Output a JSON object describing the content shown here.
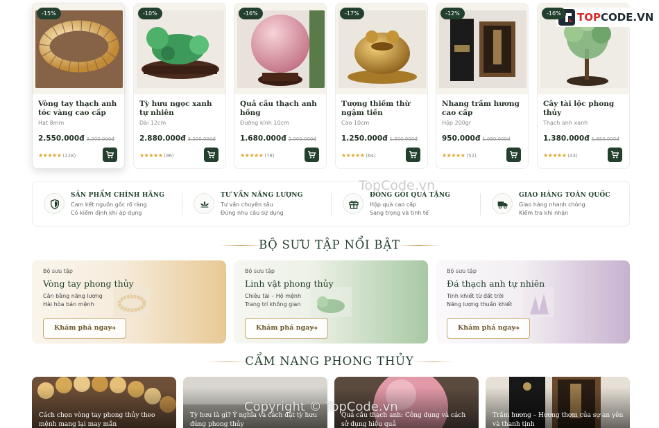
{
  "colors": {
    "primary": "#23402e",
    "gold": "#c6a76a",
    "star": "#e0a52b"
  },
  "products": [
    {
      "badge": "-15%",
      "name": "Vòng tay thạch anh tóc vàng cao cấp",
      "desc": "Hạt 8mm",
      "price": "2.550.000đ",
      "old_price": "3.000.000đ",
      "stars": "★★★★★",
      "reviews": "(128)"
    },
    {
      "badge": "-10%",
      "name": "Tỳ hưu ngọc xanh tự nhiên",
      "desc": "Dài 12cm",
      "price": "2.880.000đ",
      "old_price": "3.200.000đ",
      "stars": "★★★★★",
      "reviews": "(96)"
    },
    {
      "badge": "-16%",
      "name": "Quả cầu thạch anh hồng",
      "desc": "Đường kính 10cm",
      "price": "1.680.000đ",
      "old_price": "2.000.000đ",
      "stars": "★★★★★",
      "reviews": "(78)"
    },
    {
      "badge": "-17%",
      "name": "Tượng thiềm thừ ngậm tiền",
      "desc": "Cao 10cm",
      "price": "1.250.000đ",
      "old_price": "1.500.000đ",
      "stars": "★★★★★",
      "reviews": "(64)"
    },
    {
      "badge": "-12%",
      "name": "Nhang trầm hương cao cấp",
      "desc": "Hộp 200gr",
      "price": "950.000đ",
      "old_price": "1.080.000đ",
      "stars": "★★★★★",
      "reviews": "(52)"
    },
    {
      "badge": "-16%",
      "name": "Cây tài lộc phong thủy",
      "desc": "Thạch anh xanh",
      "price": "1.380.000đ",
      "old_price": "1.650.000đ",
      "stars": "★★★★★",
      "reviews": "(43)"
    }
  ],
  "features": [
    {
      "icon": "shield-icon",
      "title": "SẢN PHẨM CHÍNH HÃNG",
      "line1": "Cam kết nguồn gốc rõ ràng",
      "line2": "Có kiểm định khi áp dụng"
    },
    {
      "icon": "lotus-icon",
      "title": "TƯ VẤN NĂNG LƯỢNG",
      "line1": "Tư vấn chuyên sâu",
      "line2": "Đúng nhu cầu sử dụng"
    },
    {
      "icon": "gift-icon",
      "title": "ĐÓNG GÓI QUÀ TẶNG",
      "line1": "Hộp quà cao cấp",
      "line2": "Sang trọng và tinh tế"
    },
    {
      "icon": "truck-icon",
      "title": "GIAO HÀNG TOÀN QUỐC",
      "line1": "Giao hàng nhanh chóng",
      "line2": "Kiểm tra khi nhận"
    }
  ],
  "collections_heading": "BỘ SƯU TẬP NỔI BẬT",
  "collections": [
    {
      "tag": "Bộ sưu tập",
      "title": "Vòng tay phong thủy",
      "line1": "Cân bằng năng lượng",
      "line2": "Hài hòa bản mệnh",
      "button": "Khám phá ngay",
      "arrow": "→"
    },
    {
      "tag": "Bộ sưu tập",
      "title": "Linh vật phong thủy",
      "line1": "Chiêu tài – Hộ mệnh",
      "line2": "Trang trí không gian",
      "button": "Khám phá ngay",
      "arrow": "→"
    },
    {
      "tag": "Bộ sưu tập",
      "title": "Đá thạch anh tự nhiên",
      "line1": "Tinh khiết từ đất trời",
      "line2": "Năng lượng thuần khiết",
      "button": "Khám phá ngay",
      "arrow": "→"
    }
  ],
  "guide_heading": "CẨM NANG PHONG THỦY",
  "blog": [
    {
      "title": "Cách chọn vòng tay phong thủy theo mệnh mang lại may mắn"
    },
    {
      "title": "Tỳ hưu là gì? Ý nghĩa và cách đặt tỳ hưu đúng phong thủy"
    },
    {
      "title": "Quả cầu thạch anh: Công dụng và cách sử dụng hiệu quả"
    },
    {
      "title": "Trầm hương – Hương thơm của sự an yên và thanh tịnh"
    }
  ],
  "logo": {
    "prefix": "TOP",
    "suffix": "CODE.VN"
  },
  "watermark_top": "TopCode.vn",
  "watermark_bottom": "Copyright © TopCode.vn"
}
